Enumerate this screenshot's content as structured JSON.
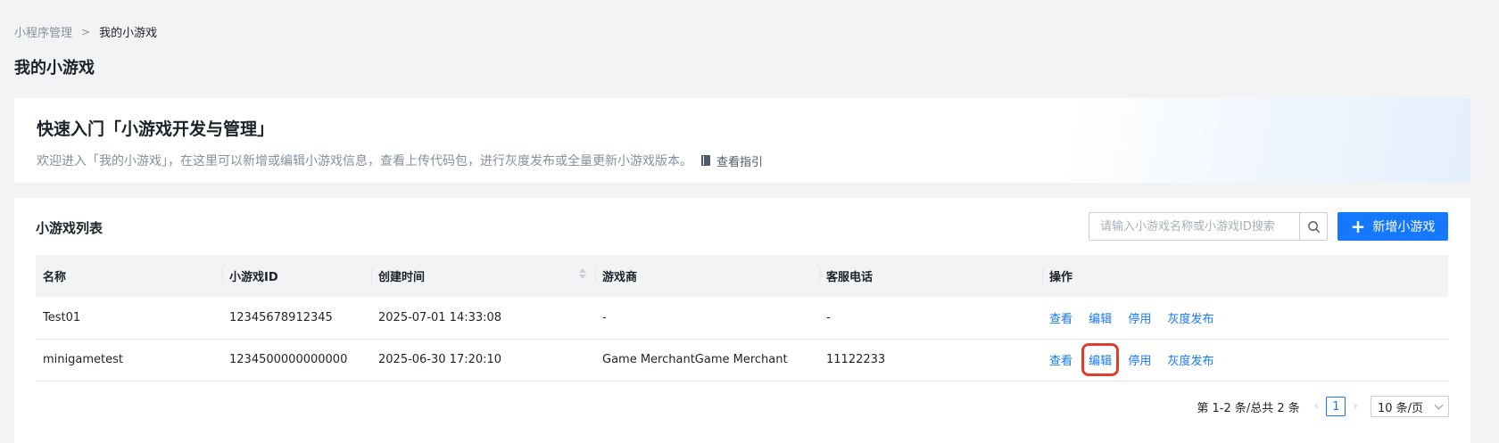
{
  "breadcrumb": {
    "parent": "小程序管理",
    "separator": ">",
    "current": "我的小游戏"
  },
  "page_title": "我的小游戏",
  "intro": {
    "title": "快速入门「小游戏开发与管理」",
    "description": "欢迎进入「我的小游戏」，在这里可以新增或编辑小游戏信息，查看上传代码包，进行灰度发布或全量更新小游戏版本。",
    "guide_link": "查看指引",
    "guide_icon": "book-icon"
  },
  "list": {
    "title": "小游戏列表",
    "search_placeholder": "请输入小游戏名称或小游戏ID搜索",
    "search_icon": "search-icon",
    "add_button": "新增小游戏",
    "columns": [
      "名称",
      "小游戏ID",
      "创建时间",
      "游戏商",
      "客服电话",
      "操作"
    ],
    "rows": [
      {
        "name": "Test01",
        "id": "12345678912345",
        "created": "2025-07-01 14:33:08",
        "merchant": "-",
        "phone": "-"
      },
      {
        "name": "minigametest",
        "id": "1234500000000000",
        "created": "2025-06-30 17:20:10",
        "merchant": "Game MerchantGame Merchant",
        "phone": "11122233"
      }
    ],
    "actions": [
      "查看",
      "编辑",
      "停用",
      "灰度发布"
    ]
  },
  "pagination": {
    "summary": "第 1-2 条/总共 2 条",
    "current_page": "1",
    "page_size": "10 条/页",
    "prev_icon": "‹",
    "next_icon": "›"
  },
  "colors": {
    "primary": "#1677ff",
    "highlight": "#e03e2d"
  }
}
